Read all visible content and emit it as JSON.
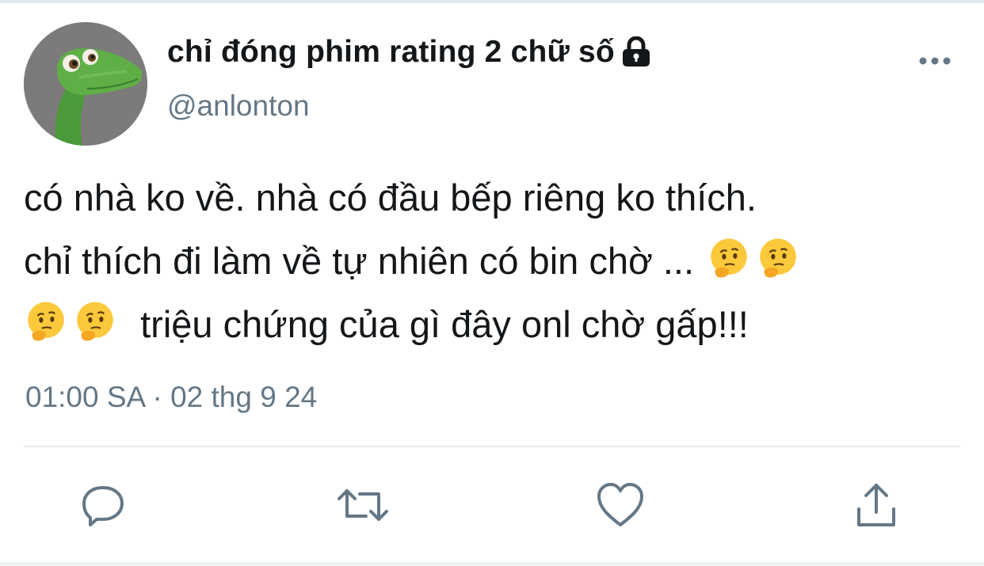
{
  "user": {
    "display_name": "chỉ đóng phim rating 2 chữ số",
    "handle": "@anlonton",
    "protected_icon": "lock-icon",
    "avatar_icon": "dinosaur-avatar"
  },
  "tweet": {
    "line1": "có nhà ko về. nhà có đầu bếp riêng ko thích.",
    "line2": "chỉ thích đi làm về tự nhiên có bin chờ ...",
    "line3": "triệu chứng của gì đây onl chờ gấp!!!",
    "emoji": "thinking-face-icon",
    "timestamp": "01:00 SA · 02 thg 9 24"
  },
  "actions": [
    {
      "name": "reply",
      "icon": "reply-icon"
    },
    {
      "name": "retweet",
      "icon": "retweet-icon"
    },
    {
      "name": "like",
      "icon": "heart-icon"
    },
    {
      "name": "share",
      "icon": "share-icon"
    }
  ],
  "more_menu": {
    "icon": "more-options-icon"
  },
  "colors": {
    "text_primary": "#14171a",
    "text_secondary": "#657786",
    "icon": "#657786",
    "divider": "#e6ecf0",
    "emoji_face": "#fbc93b"
  }
}
